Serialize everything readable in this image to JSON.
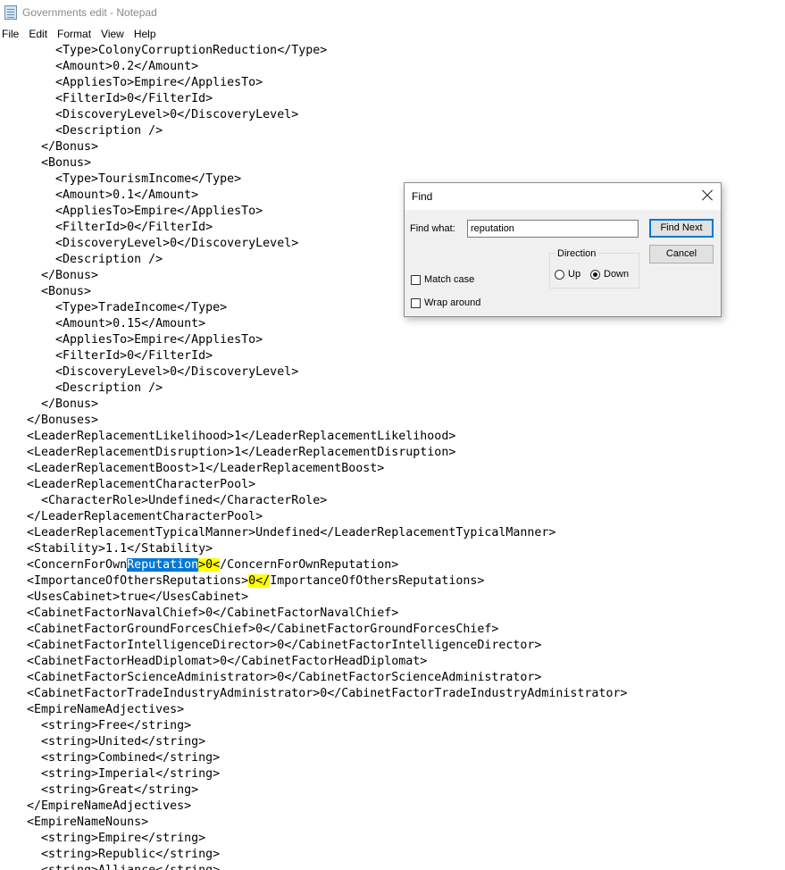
{
  "window": {
    "title": "Governments edit - Notepad"
  },
  "menu": [
    "File",
    "Edit",
    "Format",
    "View",
    "Help"
  ],
  "editor": {
    "lines": [
      {
        "text": "    <Type>ColonyCorruptionReduction</Type>"
      },
      {
        "text": "    <Amount>0.2</Amount>"
      },
      {
        "text": "    <AppliesTo>Empire</AppliesTo>"
      },
      {
        "text": "    <FilterId>0</FilterId>"
      },
      {
        "text": "    <DiscoveryLevel>0</DiscoveryLevel>"
      },
      {
        "text": "    <Description />"
      },
      {
        "text": "  </Bonus>"
      },
      {
        "text": "  <Bonus>"
      },
      {
        "text": "    <Type>TourismIncome</Type>"
      },
      {
        "text": "    <Amount>0.1</Amount>"
      },
      {
        "text": "    <AppliesTo>Empire</AppliesTo>"
      },
      {
        "text": "    <FilterId>0</FilterId>"
      },
      {
        "text": "    <DiscoveryLevel>0</DiscoveryLevel>"
      },
      {
        "text": "    <Description />"
      },
      {
        "text": "  </Bonus>"
      },
      {
        "text": "  <Bonus>"
      },
      {
        "text": "    <Type>TradeIncome</Type>"
      },
      {
        "text": "    <Amount>0.15</Amount>"
      },
      {
        "text": "    <AppliesTo>Empire</AppliesTo>"
      },
      {
        "text": "    <FilterId>0</FilterId>"
      },
      {
        "text": "    <DiscoveryLevel>0</DiscoveryLevel>"
      },
      {
        "text": "    <Description />"
      },
      {
        "text": "  </Bonus>"
      },
      {
        "text": "</Bonuses>"
      },
      {
        "text": "<LeaderReplacementLikelihood>1</LeaderReplacementLikelihood>"
      },
      {
        "text": "<LeaderReplacementDisruption>1</LeaderReplacementDisruption>"
      },
      {
        "text": "<LeaderReplacementBoost>1</LeaderReplacementBoost>"
      },
      {
        "text": "<LeaderReplacementCharacterPool>"
      },
      {
        "text": "  <CharacterRole>Undefined</CharacterRole>"
      },
      {
        "text": "</LeaderReplacementCharacterPool>"
      },
      {
        "text": "<LeaderReplacementTypicalManner>Undefined</LeaderReplacementTypicalManner>"
      },
      {
        "text": "<Stability>1.1</Stability>"
      },
      {
        "segments": [
          {
            "text": "<ConcernForOwn",
            "style": ""
          },
          {
            "text": "Reputation",
            "style": "sel"
          },
          {
            "text": ">0<",
            "style": "hl"
          },
          {
            "text": "/ConcernForOwnReputation>",
            "style": ""
          }
        ]
      },
      {
        "segments": [
          {
            "text": "<ImportanceOfOthersReputations>",
            "style": ""
          },
          {
            "text": "0</",
            "style": "hl"
          },
          {
            "text": "ImportanceOfOthersReputations>",
            "style": ""
          }
        ]
      },
      {
        "text": "<UsesCabinet>true</UsesCabinet>"
      },
      {
        "text": "<CabinetFactorNavalChief>0</CabinetFactorNavalChief>"
      },
      {
        "text": "<CabinetFactorGroundForcesChief>0</CabinetFactorGroundForcesChief>"
      },
      {
        "text": "<CabinetFactorIntelligenceDirector>0</CabinetFactorIntelligenceDirector>"
      },
      {
        "text": "<CabinetFactorHeadDiplomat>0</CabinetFactorHeadDiplomat>"
      },
      {
        "text": "<CabinetFactorScienceAdministrator>0</CabinetFactorScienceAdministrator>"
      },
      {
        "text": "<CabinetFactorTradeIndustryAdministrator>0</CabinetFactorTradeIndustryAdministrator>"
      },
      {
        "text": "<EmpireNameAdjectives>"
      },
      {
        "text": "  <string>Free</string>"
      },
      {
        "text": "  <string>United</string>"
      },
      {
        "text": "  <string>Combined</string>"
      },
      {
        "text": "  <string>Imperial</string>"
      },
      {
        "text": "  <string>Great</string>"
      },
      {
        "text": "</EmpireNameAdjectives>"
      },
      {
        "text": "<EmpireNameNouns>"
      },
      {
        "text": "  <string>Empire</string>"
      },
      {
        "text": "  <string>Republic</string>"
      },
      {
        "text": "  <string>Alliance</string>"
      }
    ]
  },
  "find_dialog": {
    "title": "Find",
    "find_what_label": "Find what:",
    "find_what_value": "reputation",
    "find_next_label": "Find Next",
    "cancel_label": "Cancel",
    "direction_label": "Direction",
    "up_label": "Up",
    "down_label": "Down",
    "direction_selected": "Down",
    "match_case_label": "Match case",
    "match_case_checked": false,
    "wrap_around_label": "Wrap around",
    "wrap_around_checked": false
  },
  "colors": {
    "selection": "#0078d7",
    "highlight": "#ffff00",
    "dialog_default_border": "#0078d7"
  }
}
